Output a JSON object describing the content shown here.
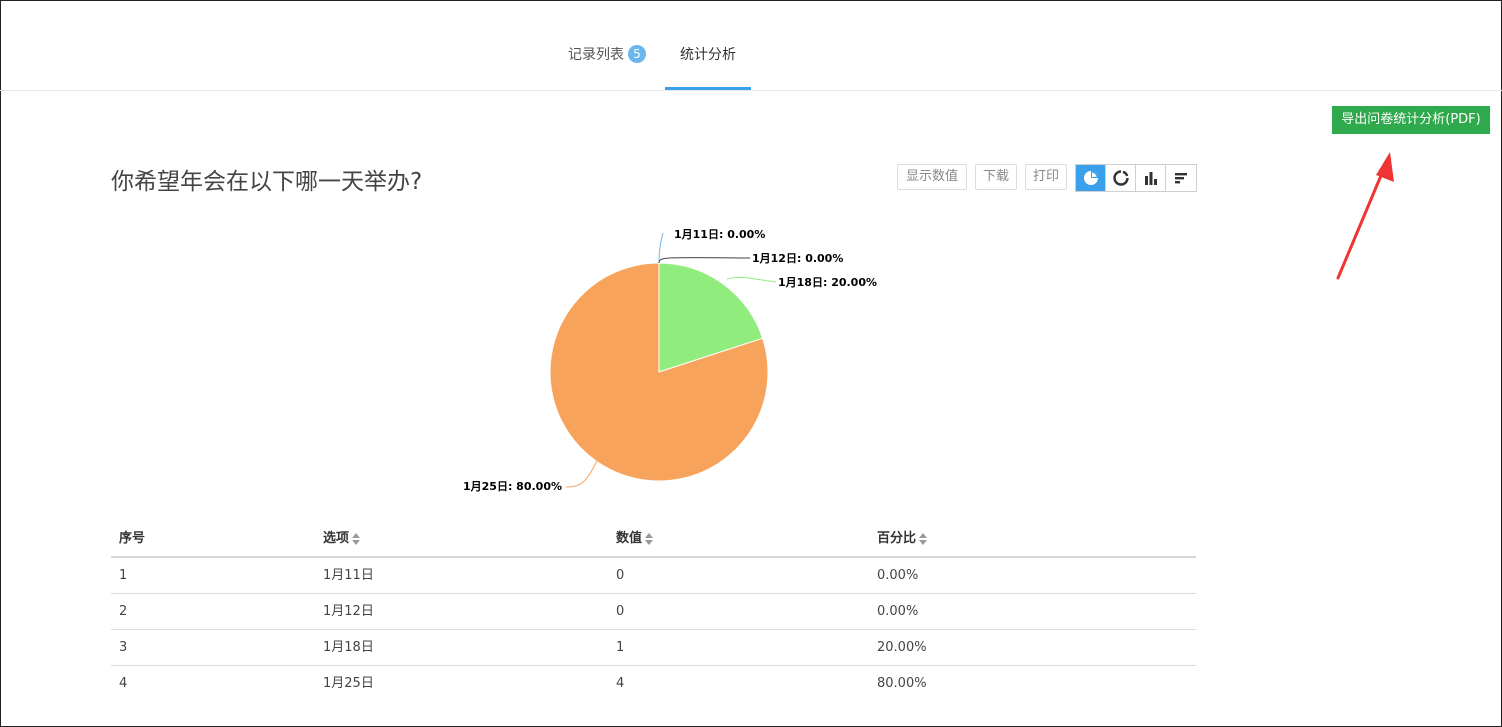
{
  "tabs": {
    "records_label": "记录列表",
    "records_badge": "5",
    "stats_label": "统计分析"
  },
  "export_button": "导出问卷统计分析(PDF)",
  "question": "你希望年会在以下哪一天举办?",
  "toolbar": {
    "show_values": "显示数值",
    "download": "下载",
    "print": "打印",
    "chart_types": [
      "pie-chart-icon",
      "donut-chart-icon",
      "bar-chart-icon",
      "horizontal-bar-chart-icon"
    ],
    "active_chart_type": "pie"
  },
  "chart_data": {
    "type": "pie",
    "slices": [
      {
        "label": "1月11日",
        "value": 0,
        "percent_text": "1月11日: 0.00%",
        "color": "#7cb5ec"
      },
      {
        "label": "1月12日",
        "value": 0,
        "percent_text": "1月12日: 0.00%",
        "color": "#434348"
      },
      {
        "label": "1月18日",
        "value": 20,
        "percent_text": "1月18日: 20.00%",
        "color": "#90ed7d"
      },
      {
        "label": "1月25日",
        "value": 80,
        "percent_text": "1月25日: 80.00%",
        "color": "#f7a35c"
      }
    ]
  },
  "table": {
    "headers": [
      "序号",
      "选项",
      "数值",
      "百分比"
    ],
    "rows": [
      [
        "1",
        "1月11日",
        "0",
        "0.00%"
      ],
      [
        "2",
        "1月12日",
        "0",
        "0.00%"
      ],
      [
        "3",
        "1月18日",
        "1",
        "20.00%"
      ],
      [
        "4",
        "1月25日",
        "4",
        "80.00%"
      ]
    ]
  },
  "colors": {
    "accent": "#3aa0ec",
    "export_green": "#2ea94b",
    "arrow_red": "#f03434"
  }
}
